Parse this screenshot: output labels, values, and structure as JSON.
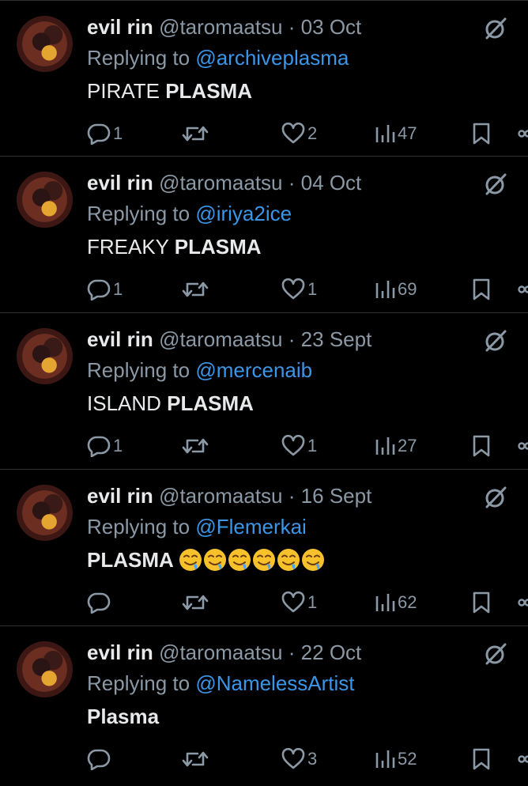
{
  "tweets": [
    {
      "author_name": "evil rin",
      "handle": "@taromaatsu",
      "separator": "·",
      "date": "03 Oct",
      "replying_prefix": "Replying to",
      "replying_to": "@archiveplasma",
      "text_plain": "PIRATE ",
      "text_bold": "PLASMA",
      "emoji_count": 0,
      "replies": "1",
      "reposts": "",
      "likes": "2",
      "views": "47"
    },
    {
      "author_name": "evil rin",
      "handle": "@taromaatsu",
      "separator": "·",
      "date": "04 Oct",
      "replying_prefix": "Replying to",
      "replying_to": "@iriya2ice",
      "text_plain": "FREAKY ",
      "text_bold": "PLASMA",
      "emoji_count": 0,
      "replies": "1",
      "reposts": "",
      "likes": "1",
      "views": "69"
    },
    {
      "author_name": "evil rin",
      "handle": "@taromaatsu",
      "separator": "·",
      "date": "23 Sept",
      "replying_prefix": "Replying to",
      "replying_to": "@mercenaib",
      "text_plain": "ISLAND ",
      "text_bold": "PLASMA",
      "emoji_count": 0,
      "replies": "1",
      "reposts": "",
      "likes": "1",
      "views": "27"
    },
    {
      "author_name": "evil rin",
      "handle": "@taromaatsu",
      "separator": "·",
      "date": "16 Sept",
      "replying_prefix": "Replying to",
      "replying_to": "@Flemerkai",
      "text_plain": "",
      "text_bold": "PLASMA ",
      "emoji_count": 6,
      "emoji_name": "drooling-face-emoji",
      "replies": "",
      "reposts": "",
      "likes": "1",
      "views": "62"
    },
    {
      "author_name": "evil rin",
      "handle": "@taromaatsu",
      "separator": "·",
      "date": "22 Oct",
      "replying_prefix": "Replying to",
      "replying_to": "@NamelessArtist",
      "text_plain": "",
      "text_bold": "Plasma",
      "emoji_count": 0,
      "replies": "",
      "reposts": "",
      "likes": "3",
      "views": "52"
    }
  ],
  "icons": {
    "reply": "reply-icon",
    "repost": "repost-icon",
    "like": "heart-icon",
    "views": "views-chart-icon",
    "bookmark": "bookmark-icon",
    "share": "share-icon",
    "grok": "grok-icon"
  },
  "colors": {
    "background": "#000000",
    "text": "#e7e9ea",
    "secondary": "#8b98a5",
    "link": "#3b96e8",
    "divider": "#2f3336"
  }
}
